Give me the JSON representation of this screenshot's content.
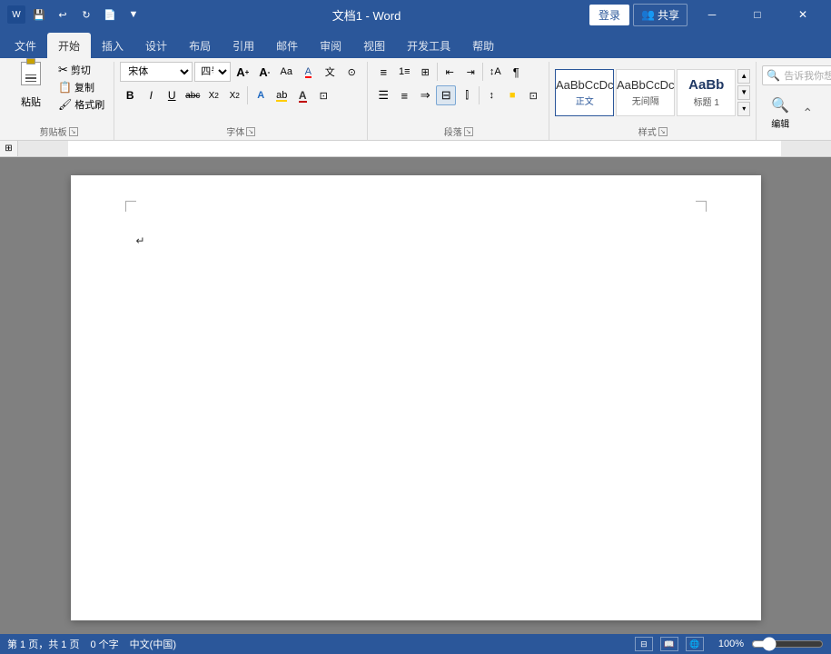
{
  "titleBar": {
    "title": "文档1 - Word",
    "appName": "Word",
    "loginBtn": "登录",
    "shareBtn": "共享",
    "shareIcon": "👥",
    "quickAccess": {
      "saveIcon": "💾",
      "undoIcon": "↩",
      "redoIcon": "↻",
      "openIcon": "📄",
      "moreIcon": "▼"
    }
  },
  "ribbonTabs": {
    "tabs": [
      "文件",
      "开始",
      "插入",
      "设计",
      "布局",
      "引用",
      "邮件",
      "审阅",
      "视图",
      "开发工具",
      "帮助"
    ],
    "activeTab": "开始"
  },
  "ribbon": {
    "groups": {
      "clipboard": {
        "label": "剪贴板",
        "pasteLabel": "粘贴",
        "cutLabel": "剪切",
        "copyLabel": "复制",
        "formatLabel": "格式刷"
      },
      "font": {
        "label": "字体",
        "fontName": "宋体",
        "fontSize": "四号",
        "growBtn": "A",
        "shrinkBtn": "A",
        "caseBtn": "Aa",
        "clearBtn": "A",
        "pinyinBtn": "文",
        "encircleBtn": "⊙",
        "boldBtn": "B",
        "italicBtn": "I",
        "underlineBtn": "U",
        "strikeBtn": "abc",
        "subBtn": "X₂",
        "supBtn": "X²",
        "fontColorBtn": "A",
        "highlightBtn": "ab",
        "shadingBtn": "A",
        "borderBtn": "⊞"
      },
      "paragraph": {
        "label": "段落",
        "bulletBtn": "≡",
        "numberBtn": "1≡",
        "multiLevelBtn": "⊞≡",
        "decreaseIndentBtn": "←≡",
        "increaseIndentBtn": "→≡",
        "sortBtn": "↕A",
        "showHideBtn": "¶",
        "alignLeftBtn": "≡",
        "centerBtn": "≡",
        "alignRightBtn": "≡",
        "justifyBtn": "≡",
        "columnsBtn": "⫿",
        "lineSpacingBtn": "↕≡",
        "shadingBtnP": "🔲",
        "borderBtnP": "⊡",
        "moreBtn": "▼"
      },
      "styles": {
        "label": "样式",
        "items": [
          {
            "name": "正文",
            "preview": "AaBbCcDc",
            "active": true
          },
          {
            "name": "无间隔",
            "preview": "AaBbCcDc"
          },
          {
            "name": "标题 1",
            "preview": "AaBb"
          }
        ]
      },
      "editSearch": {
        "searchPlaceholder": "告诉我你想要做什么",
        "searchIcon": "🔍"
      },
      "editing": {
        "label": "编辑",
        "icon": "🔍"
      }
    }
  },
  "document": {
    "pageIndicator": "第 1 页，共 1 页",
    "wordCount": "0 个字",
    "language": "中文(中国)",
    "zoom": "100%",
    "enterMark": "↵"
  },
  "statusBar": {
    "pageInfo": "第 1 页，共 1 页",
    "wordCount": "0 个字",
    "language": "中文(中国)",
    "zoom": "100%"
  }
}
